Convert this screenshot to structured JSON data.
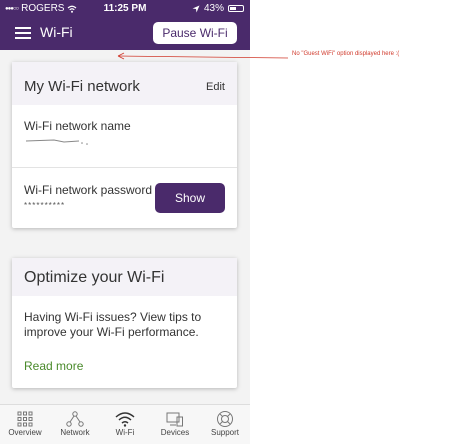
{
  "status_bar": {
    "carrier": "ROGERS",
    "time": "11:25 PM",
    "battery": "43%"
  },
  "header": {
    "title": "Wi-Fi",
    "pause_label": "Pause Wi-Fi"
  },
  "network_card": {
    "title": "My Wi-Fi network",
    "edit_label": "Edit",
    "name_label": "Wi-Fi network name",
    "password_label": "Wi-Fi network password",
    "password_value": "**********",
    "show_label": "Show"
  },
  "optimize_card": {
    "title": "Optimize your Wi-Fi",
    "body": "Having Wi-Fi issues? View tips to improve your Wi-Fi performance.",
    "link_label": "Read more"
  },
  "tabs": [
    {
      "label": "Overview",
      "icon": "grid-icon"
    },
    {
      "label": "Network",
      "icon": "network-icon"
    },
    {
      "label": "Wi-Fi",
      "icon": "wifi-icon"
    },
    {
      "label": "Devices",
      "icon": "devices-icon"
    },
    {
      "label": "Support",
      "icon": "support-icon"
    }
  ],
  "annotation": {
    "text": "No \"Guest WiFi\" option displayed here :("
  },
  "colors": {
    "brand": "#4a2a6b",
    "link": "#4a8a2b",
    "annotation": "#d0392b"
  }
}
